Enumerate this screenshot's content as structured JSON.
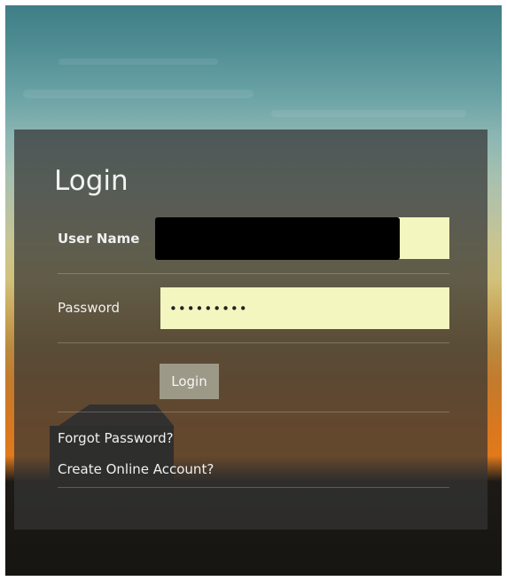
{
  "login_form": {
    "title": "Login",
    "username_label": "User Name",
    "username_value": "",
    "password_label": "Password",
    "password_value": "•••••••••",
    "submit_label": "Login",
    "forgot_password_link": "Forgot Password?",
    "create_account_link": "Create Online Account?"
  },
  "colors": {
    "input_background": "#f3f6bf",
    "panel_background": "rgba(52,52,52,0.72)",
    "button_background": "rgba(175,175,160,0.78)"
  }
}
